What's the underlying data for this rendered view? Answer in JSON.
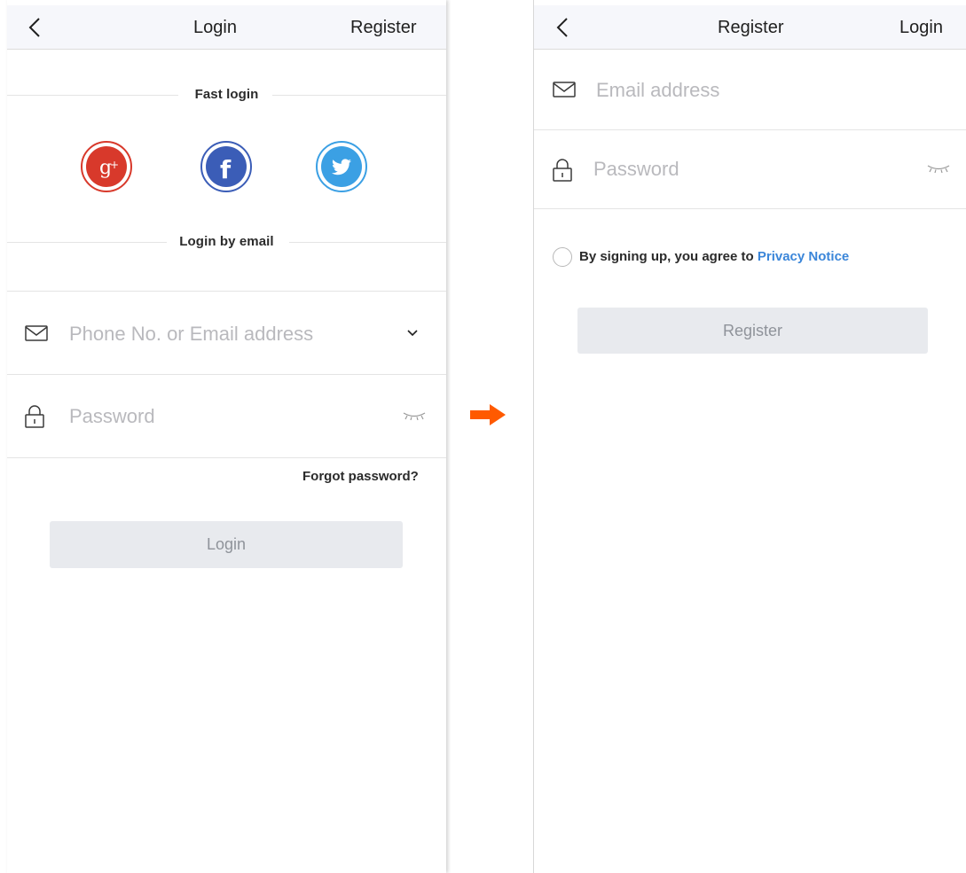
{
  "login_screen": {
    "nav": {
      "title": "Login",
      "action": "Register"
    },
    "fast_login_label": "Fast login",
    "email_login_label": "Login by email",
    "social": [
      "google-plus-icon",
      "facebook-icon",
      "twitter-icon"
    ],
    "account_placeholder": "Phone No. or Email address",
    "password_placeholder": "Password",
    "forgot_password": "Forgot password?",
    "login_button": "Login"
  },
  "register_screen": {
    "nav": {
      "title": "Register",
      "action": "Login"
    },
    "email_placeholder": "Email address",
    "password_placeholder": "Password",
    "agreement_prefix": "By signing up, you agree to ",
    "privacy_link": "Privacy Notice",
    "register_button": "Register"
  },
  "colors": {
    "accent_link": "#3b86d9",
    "transition_arrow": "#ff5a00",
    "google": "#d8392b",
    "facebook": "#3b5db7",
    "twitter": "#3ba0e4"
  }
}
